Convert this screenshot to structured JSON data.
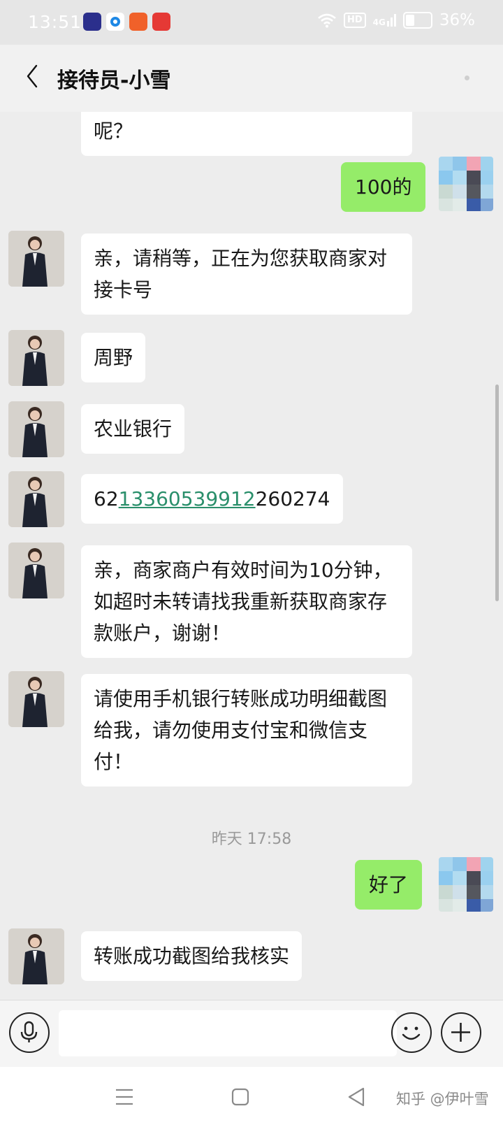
{
  "status_bar": {
    "time": "13:51",
    "app_icons": [
      {
        "name": "app-icon-dark-blue",
        "color": "#2b2f8c"
      },
      {
        "name": "app-icon-blue-ring",
        "color": "#1e88e5"
      },
      {
        "name": "app-icon-orange",
        "color": "#f0612a"
      },
      {
        "name": "app-icon-red-video",
        "color": "#e53935"
      }
    ],
    "hd": "HD",
    "network": "4G",
    "battery": "36%",
    "battery_level": 0.36
  },
  "header": {
    "title": "接待员-小雪"
  },
  "messages": [
    {
      "sender": "agent",
      "text": "呢？"
    },
    {
      "sender": "me",
      "text": "100的"
    },
    {
      "sender": "agent",
      "text": "亲，请稍等，正在为您获取商家对接卡号"
    },
    {
      "sender": "agent",
      "text": "周野"
    },
    {
      "sender": "agent",
      "text": "农业银行"
    },
    {
      "sender": "agent",
      "text_prefix": "62",
      "text_link": "13360539912",
      "text_suffix": "260274"
    },
    {
      "sender": "agent",
      "text": "亲，商家商户有效时间为10分钟，如超时未转请找我重新获取商家存款账户，谢谢！"
    },
    {
      "sender": "agent",
      "text": "请使用手机银行转账成功明细截图给我，请勿使用支付宝和微信支付！"
    },
    {
      "sender": "me",
      "text": "好了"
    },
    {
      "sender": "agent",
      "text": "转账成功截图给我核实"
    }
  ],
  "timestamp": "昨天 17:58",
  "input_bar": {
    "placeholder": ""
  },
  "watermark": "知乎 @伊叶雪",
  "colors": {
    "outgoing_bubble": "#95ec69",
    "incoming_bubble": "#ffffff",
    "chat_background": "#ededed",
    "link": "#2a8f6b"
  }
}
